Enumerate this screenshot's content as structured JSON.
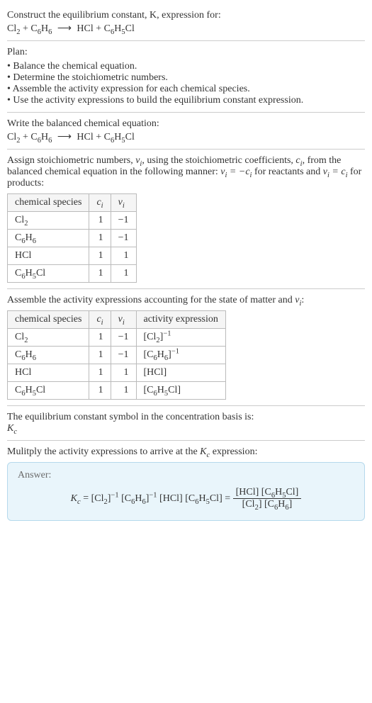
{
  "intro": {
    "line1": "Construct the equilibrium constant, K, expression for:"
  },
  "equation_display": {
    "lhs1": "Cl",
    "lhs1_sub": "2",
    "plus1": " + ",
    "lhs2": "C",
    "lhs2_sub1": "6",
    "lhs2_h": "H",
    "lhs2_sub2": "6",
    "arrow": "⟶",
    "rhs1": "HCl",
    "plus2": " + ",
    "rhs2": "C",
    "rhs2_sub1": "6",
    "rhs2_h": "H",
    "rhs2_sub2": "5",
    "rhs2_cl": "Cl"
  },
  "plan": {
    "heading": "Plan:",
    "items": [
      "Balance the chemical equation.",
      "Determine the stoichiometric numbers.",
      "Assemble the activity expression for each chemical species.",
      "Use the activity expressions to build the equilibrium constant expression."
    ]
  },
  "balanced_heading": "Write the balanced chemical equation:",
  "assign_text": {
    "p1a": "Assign stoichiometric numbers, ",
    "nu_i": "ν",
    "nu_sub": "i",
    "p1b": ", using the stoichiometric coefficients, ",
    "c_i": "c",
    "c_sub": "i",
    "p1c": ", from the balanced chemical equation in the following manner: ",
    "eq1": "ν",
    "eq1_sub": "i",
    "eq1_eq": " = −",
    "eq1_c": "c",
    "eq1_csub": "i",
    "p1d": " for reactants and ",
    "eq2": "ν",
    "eq2_sub": "i",
    "eq2_eq": " = ",
    "eq2_c": "c",
    "eq2_csub": "i",
    "p1e": " for products:"
  },
  "table1": {
    "headers": {
      "species": "chemical species",
      "ci": "c",
      "ci_sub": "i",
      "nui": "ν",
      "nui_sub": "i"
    },
    "rows": [
      {
        "species_html": "Cl<sub>2</sub>",
        "ci": "1",
        "nui": "−1"
      },
      {
        "species_html": "C<sub>6</sub>H<sub>6</sub>",
        "ci": "1",
        "nui": "−1"
      },
      {
        "species_html": "HCl",
        "ci": "1",
        "nui": "1"
      },
      {
        "species_html": "C<sub>6</sub>H<sub>5</sub>Cl",
        "ci": "1",
        "nui": "1"
      }
    ]
  },
  "assemble_text": {
    "a": "Assemble the activity expressions accounting for the state of matter and ",
    "nu": "ν",
    "nu_sub": "i",
    "colon": ":"
  },
  "table2": {
    "headers": {
      "species": "chemical species",
      "ci": "c",
      "ci_sub": "i",
      "nui": "ν",
      "nui_sub": "i",
      "act": "activity expression"
    },
    "rows": [
      {
        "species_html": "Cl<sub>2</sub>",
        "ci": "1",
        "nui": "−1",
        "act_html": "[Cl<sub>2</sub>]<sup>−1</sup>"
      },
      {
        "species_html": "C<sub>6</sub>H<sub>6</sub>",
        "ci": "1",
        "nui": "−1",
        "act_html": "[C<sub>6</sub>H<sub>6</sub>]<sup>−1</sup>"
      },
      {
        "species_html": "HCl",
        "ci": "1",
        "nui": "1",
        "act_html": "[HCl]"
      },
      {
        "species_html": "C<sub>6</sub>H<sub>5</sub>Cl",
        "ci": "1",
        "nui": "1",
        "act_html": "[C<sub>6</sub>H<sub>5</sub>Cl]"
      }
    ]
  },
  "kc_symbol_text": "The equilibrium constant symbol in the concentration basis is:",
  "kc_symbol": {
    "K": "K",
    "sub": "c"
  },
  "multiply_text": {
    "a": "Mulitply the activity expressions to arrive at the ",
    "K": "K",
    "sub": "c",
    "b": " expression:"
  },
  "answer": {
    "label": "Answer:",
    "lhs": {
      "K": "K",
      "sub": "c",
      "eq": " = "
    },
    "flat": "[Cl<sub>2</sub>]<sup>−1</sup> [C<sub>6</sub>H<sub>6</sub>]<sup>−1</sup> [HCl] [C<sub>6</sub>H<sub>5</sub>Cl] = ",
    "frac_num": "[HCl] [C<sub>6</sub>H<sub>5</sub>Cl]",
    "frac_den": "[Cl<sub>2</sub>] [C<sub>6</sub>H<sub>6</sub>]"
  }
}
